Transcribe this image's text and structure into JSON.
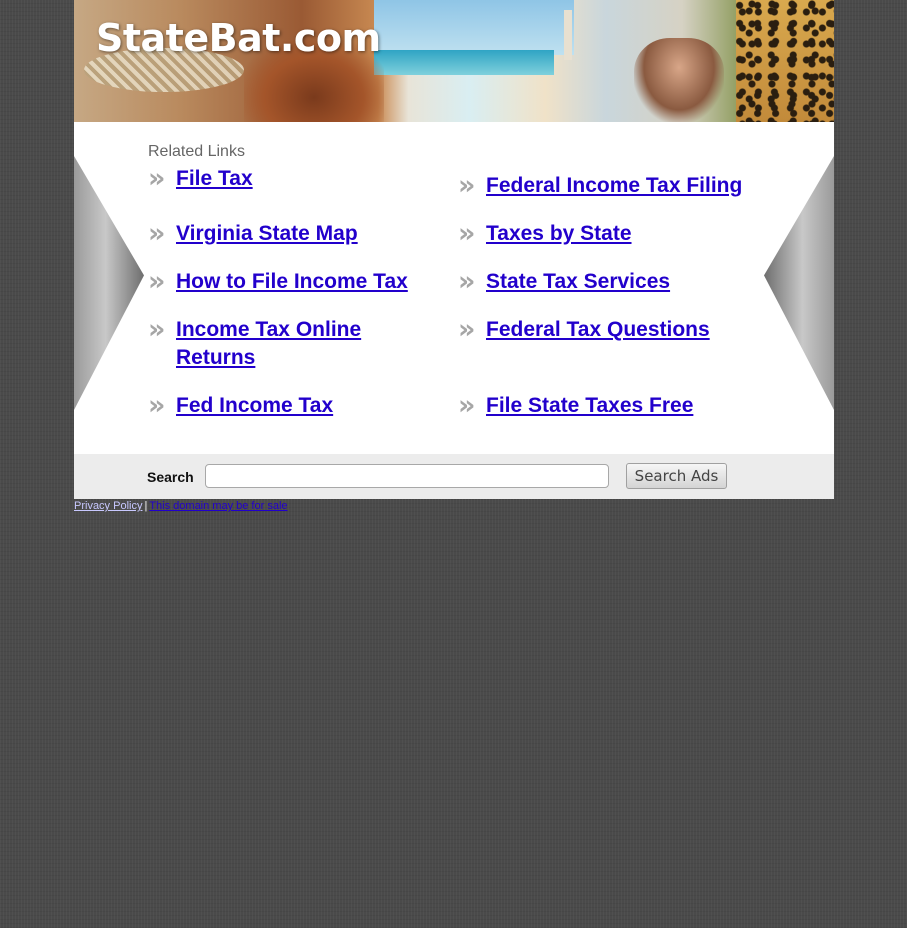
{
  "header": {
    "site_title": "StateBat.com"
  },
  "related": {
    "heading": "Related Links",
    "chevron_glyph": "»",
    "left_links": [
      {
        "label": "File Tax"
      },
      {
        "label": "Virginia State Map"
      },
      {
        "label": "How to File Income Tax"
      },
      {
        "label": "Income Tax Online Returns"
      },
      {
        "label": "Fed Income Tax"
      }
    ],
    "right_links": [
      {
        "label": "Federal Income Tax Filing"
      },
      {
        "label": "Taxes by State"
      },
      {
        "label": "State Tax Services"
      },
      {
        "label": "Federal Tax Questions"
      },
      {
        "label": "File State Taxes Free"
      }
    ]
  },
  "search": {
    "label": "Search",
    "input_value": "",
    "button_label": "Search Ads"
  },
  "footer": {
    "privacy_label": "Privacy Policy",
    "separator": "|",
    "sale_label": "This domain may be for sale"
  },
  "colors": {
    "link": "#2200cc",
    "page_background": "#4a4a4a",
    "content_background": "#ffffff",
    "searchbar_background": "#ececec",
    "chevron": "#a6a6a6"
  },
  "icons": {
    "chevron": "double-chevron-right-icon"
  }
}
